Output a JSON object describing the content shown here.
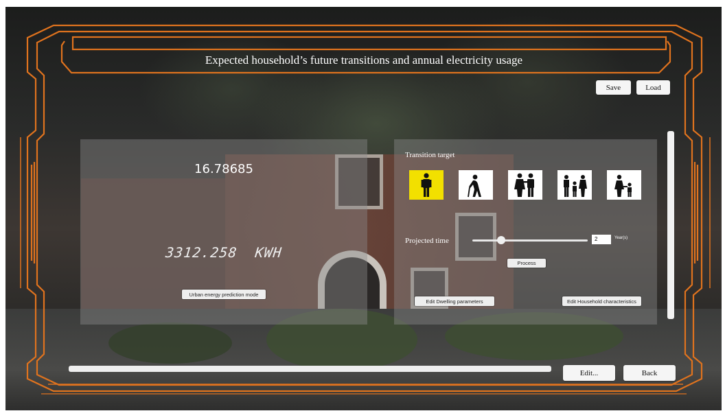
{
  "header": {
    "title": "Expected household’s future transitions and annual electricity usage",
    "save_label": "Save",
    "load_label": "Load"
  },
  "left_panel": {
    "value": "16.78685",
    "kwh_value": "3312.258",
    "kwh_unit": "KWH",
    "mode_button_label": "Urban energy prediction mode"
  },
  "right_panel": {
    "transition_target_label": "Transition target",
    "targets": [
      {
        "icon": "single-person-icon",
        "selected": true
      },
      {
        "icon": "elderly-person-icon",
        "selected": false
      },
      {
        "icon": "couple-icon",
        "selected": false
      },
      {
        "icon": "family-with-child-icon",
        "selected": false
      },
      {
        "icon": "parent-with-child-icon",
        "selected": false
      }
    ],
    "projected_time_label": "Projected time",
    "years_value": "2",
    "years_unit": "Year(s)",
    "slider_fraction": 0.25,
    "process_label": "Process",
    "edit_dwelling_label": "Edit Dwelling parameters",
    "edit_household_label": "Edit Household characteristics"
  },
  "footer": {
    "edit_label": "Edit...",
    "back_label": "Back"
  },
  "colors": {
    "frame_orange": "#e0731e",
    "selected_tile": "#f2e000",
    "panel": "rgba(140,140,140,0.42)"
  }
}
